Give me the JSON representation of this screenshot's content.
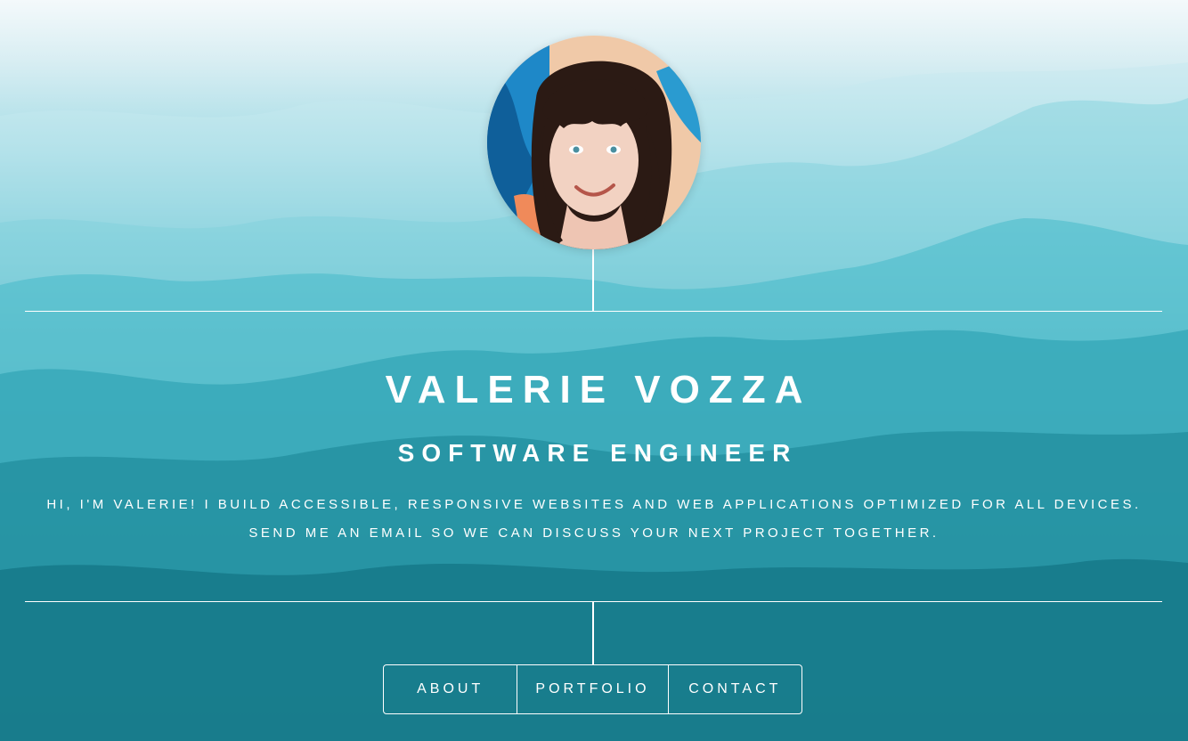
{
  "profile": {
    "avatar_label": "Valerie Vozza portrait",
    "name": "VALERIE VOZZA",
    "title": "SOFTWARE ENGINEER",
    "bio_line_1": "HI, I'M VALERIE! I BUILD ACCESSIBLE, RESPONSIVE WEBSITES AND WEB APPLICATIONS OPTIMIZED FOR ALL DEVICES.",
    "bio_line_2": "SEND ME AN EMAIL SO WE CAN DISCUSS YOUR NEXT PROJECT TOGETHER."
  },
  "nav": {
    "about": "ABOUT",
    "portfolio": "PORTFOLIO",
    "contact": "CONTACT"
  },
  "colors": {
    "text": "#ffffff",
    "sky_light": "#f4f9fb",
    "teal_mid": "#2fa6b6",
    "teal_dark": "#0a5c6a"
  }
}
